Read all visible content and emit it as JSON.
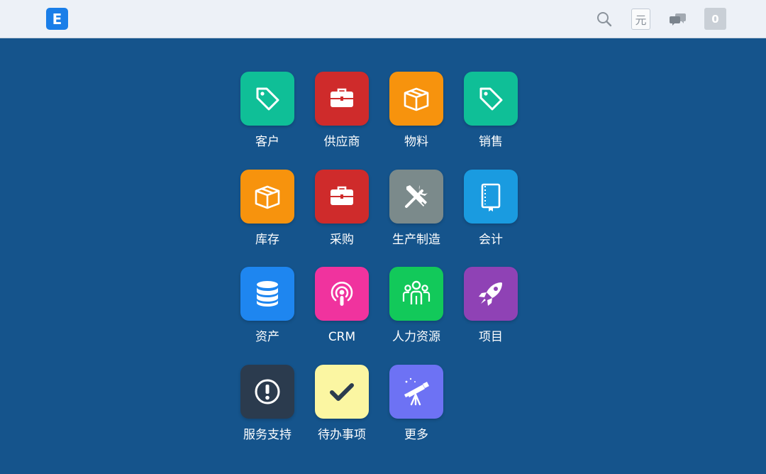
{
  "header": {
    "logo_text": "E",
    "currency_symbol": "元",
    "notification_count": "0",
    "icons": [
      "search-icon",
      "currency-icon",
      "chat-icon",
      "notification-badge"
    ]
  },
  "apps": [
    {
      "label": "客户",
      "icon": "tag-icon",
      "color": "#0fbf97"
    },
    {
      "label": "供应商",
      "icon": "briefcase-icon",
      "color": "#cf2b2b"
    },
    {
      "label": "物料",
      "icon": "box-icon",
      "color": "#f7930d"
    },
    {
      "label": "销售",
      "icon": "tag-icon",
      "color": "#0fbf97"
    },
    {
      "label": "库存",
      "icon": "box-icon",
      "color": "#f7930d"
    },
    {
      "label": "采购",
      "icon": "briefcase-icon",
      "color": "#cf2b2b"
    },
    {
      "label": "生产制造",
      "icon": "tools-icon",
      "color": "#7b8a8b"
    },
    {
      "label": "会计",
      "icon": "book-icon",
      "color": "#1a9be0"
    },
    {
      "label": "资产",
      "icon": "database-icon",
      "color": "#1e86f0"
    },
    {
      "label": "CRM",
      "icon": "podcast-icon",
      "color": "#f0339e"
    },
    {
      "label": "人力资源",
      "icon": "people-icon",
      "color": "#12c95a"
    },
    {
      "label": "项目",
      "icon": "rocket-icon",
      "color": "#8f42b5"
    },
    {
      "label": "服务支持",
      "icon": "exclamation-icon",
      "color": "#2b3b4e"
    },
    {
      "label": "待办事项",
      "icon": "check-icon",
      "color": "#fbf6a2"
    },
    {
      "label": "更多",
      "icon": "telescope-icon",
      "color": "#6d72f4"
    }
  ]
}
